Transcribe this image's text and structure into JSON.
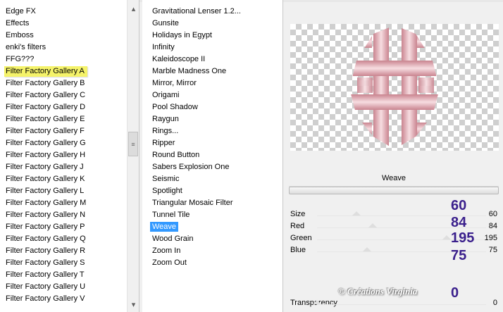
{
  "categories": {
    "items": [
      "Edge FX",
      "Effects",
      "Emboss",
      "enki's filters",
      "FFG???",
      "Filter Factory Gallery A",
      "Filter Factory Gallery B",
      "Filter Factory Gallery C",
      "Filter Factory Gallery D",
      "Filter Factory Gallery E",
      "Filter Factory Gallery F",
      "Filter Factory Gallery G",
      "Filter Factory Gallery H",
      "Filter Factory Gallery J",
      "Filter Factory Gallery K",
      "Filter Factory Gallery L",
      "Filter Factory Gallery M",
      "Filter Factory Gallery N",
      "Filter Factory Gallery P",
      "Filter Factory Gallery Q",
      "Filter Factory Gallery R",
      "Filter Factory Gallery S",
      "Filter Factory Gallery T",
      "Filter Factory Gallery U",
      "Filter Factory Gallery V"
    ],
    "highlighted": "Filter Factory Gallery A"
  },
  "filters": {
    "items": [
      "Gravitational Lenser 1.2...",
      "Gunsite",
      "Holidays in Egypt",
      "Infinity",
      "Kaleidoscope II",
      "Marble Madness One",
      "Mirror, Mirror",
      "Origami",
      "Pool Shadow",
      "Raygun",
      "Rings...",
      "Ripper",
      "Round Button",
      "Sabers Explosion One",
      "Seismic",
      "Spotlight",
      "Triangular Mosaic Filter",
      "Tunnel Tile",
      "Weave",
      "Wood Grain",
      "Zoom In",
      "Zoom Out"
    ],
    "selected": "Weave"
  },
  "preview": {
    "accent_colors": [
      "#e8b4bd",
      "#c9848f",
      "#f7dde1"
    ]
  },
  "filter_panel": {
    "title": "Weave",
    "sliders": [
      {
        "label": "Size",
        "value": "60",
        "annotation": "60",
        "level": 0.235
      },
      {
        "label": "Red",
        "value": "84",
        "annotation": "84",
        "level": 0.329
      },
      {
        "label": "Green",
        "value": "195",
        "annotation": "195",
        "level": 0.765
      },
      {
        "label": "Blue",
        "value": "75",
        "annotation": "75",
        "level": 0.294
      }
    ],
    "transparency": {
      "label": "Transparency",
      "value": "0",
      "annotation": "0",
      "level": 0
    }
  },
  "watermark": "© Créations Virginia",
  "colors": {
    "highlight": "#f5f36a",
    "selection": "#3399ff",
    "annotation": "#3a1f8c"
  }
}
